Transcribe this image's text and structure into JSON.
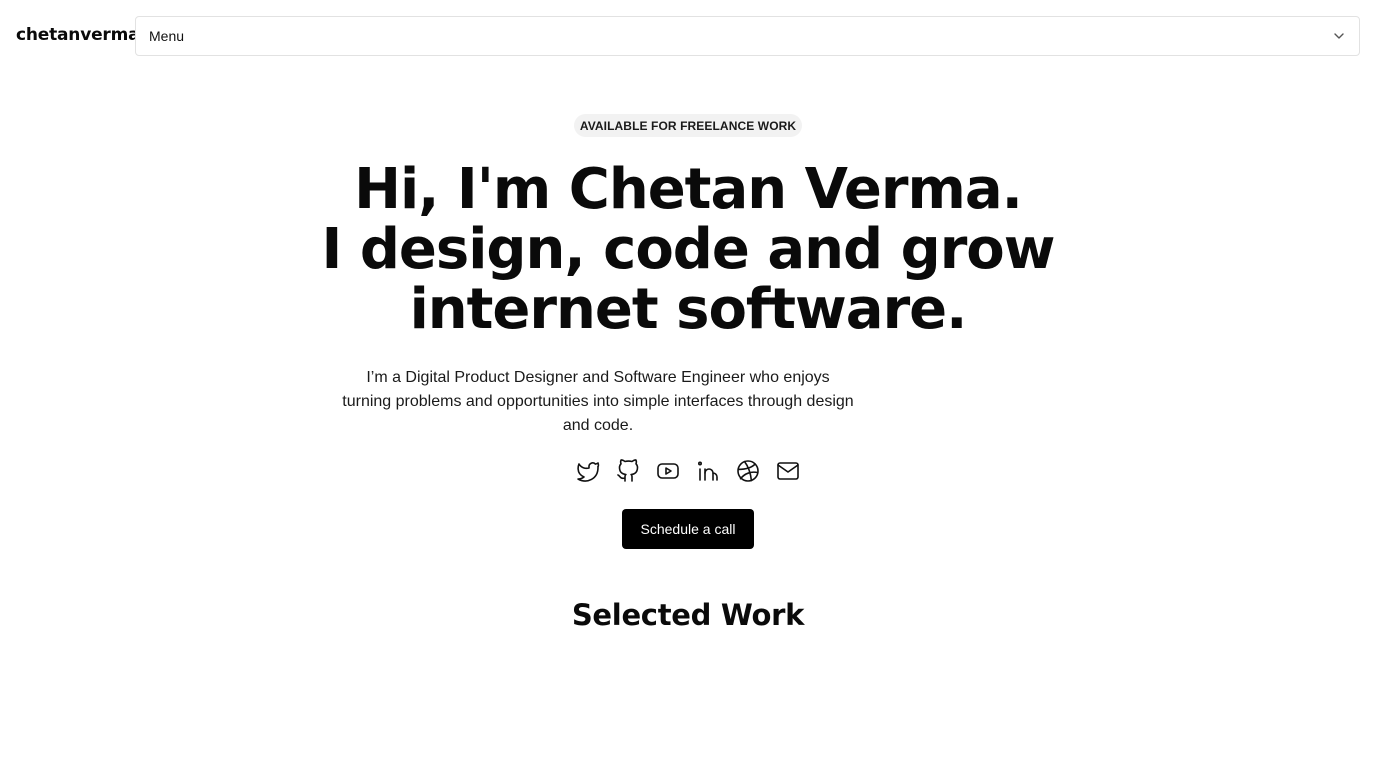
{
  "header": {
    "logo": "chetanverma.",
    "menu_label": "Menu"
  },
  "hero": {
    "badge": "AVAILABLE FOR FREELANCE WORK",
    "headline_lines": [
      "Hi, I'm Chetan Verma.",
      "I design, code and grow",
      "internet software."
    ],
    "intro": "I’m a Digital Product Designer and Software Engineer who enjoys turning problems and opportunities into simple interfaces through design and code.",
    "socials": [
      {
        "icon": "twitter-icon"
      },
      {
        "icon": "github-icon"
      },
      {
        "icon": "youtube-icon"
      },
      {
        "icon": "linkedin-icon"
      },
      {
        "icon": "dribbble-icon"
      },
      {
        "icon": "mail-icon"
      }
    ],
    "cta_label": "Schedule a call"
  },
  "work": {
    "title": "Selected Work"
  }
}
